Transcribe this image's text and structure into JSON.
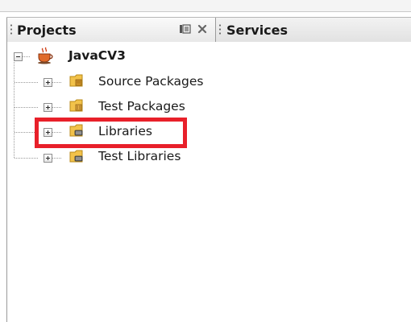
{
  "tabs": {
    "projects": {
      "label": "Projects",
      "active": true
    },
    "services": {
      "label": "Services",
      "active": false
    }
  },
  "tab_controls": {
    "minimize_icon": "minimize-window-icon",
    "close_icon": "close-icon"
  },
  "tree": {
    "root": {
      "label": "JavaCV3",
      "icon": "java-coffee-cup-icon",
      "expanded": true
    },
    "children": [
      {
        "label": "Source Packages",
        "icon": "source-package-folder-icon",
        "expanded": false
      },
      {
        "label": "Test Packages",
        "icon": "test-package-folder-icon",
        "expanded": false
      },
      {
        "label": "Libraries",
        "icon": "library-folder-icon",
        "expanded": false,
        "highlighted": true
      },
      {
        "label": "Test Libraries",
        "icon": "test-library-folder-icon",
        "expanded": false
      }
    ]
  },
  "colors": {
    "highlight": "#e8202a",
    "folder": "#f0c040"
  }
}
